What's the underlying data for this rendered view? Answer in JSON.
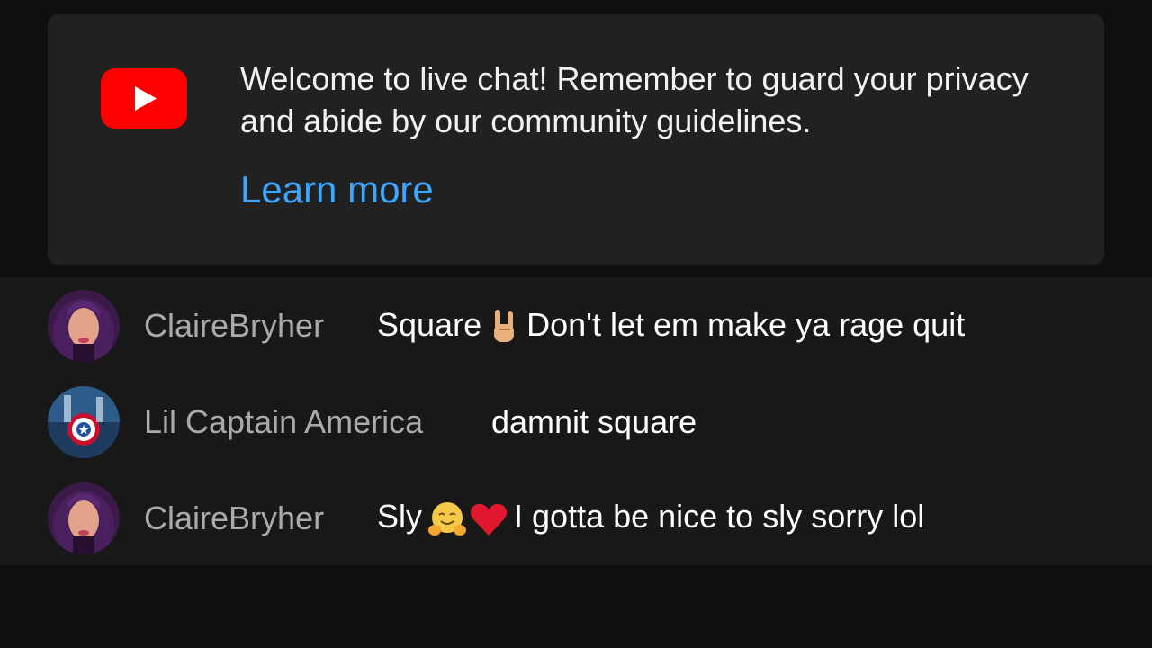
{
  "welcome": {
    "message": "Welcome to live chat! Remember to guard your privacy and abide by our community guidelines.",
    "learn_more": "Learn more"
  },
  "colors": {
    "background": "#0f0f0f",
    "card": "#212121",
    "chat_area": "#181818",
    "link": "#3ea6ff",
    "author": "#aaaaaa",
    "youtube_red": "#ff0000"
  },
  "messages": [
    {
      "author": "ClaireBryher",
      "avatar_icon": "user-avatar-icon",
      "text_before": "Square",
      "emojis": [
        "sign-of-the-horns-emoji"
      ],
      "text_after": "Don't let em make ya rage quit"
    },
    {
      "author": "Lil Captain America",
      "avatar_icon": "captain-america-avatar-icon",
      "text_before": "damnit square",
      "emojis": [],
      "text_after": ""
    },
    {
      "author": "ClaireBryher",
      "avatar_icon": "user-avatar-icon",
      "text_before": "Sly",
      "emojis": [
        "hugging-face-emoji",
        "red-heart-emoji"
      ],
      "text_after": "I gotta be nice to sly sorry lol"
    }
  ]
}
